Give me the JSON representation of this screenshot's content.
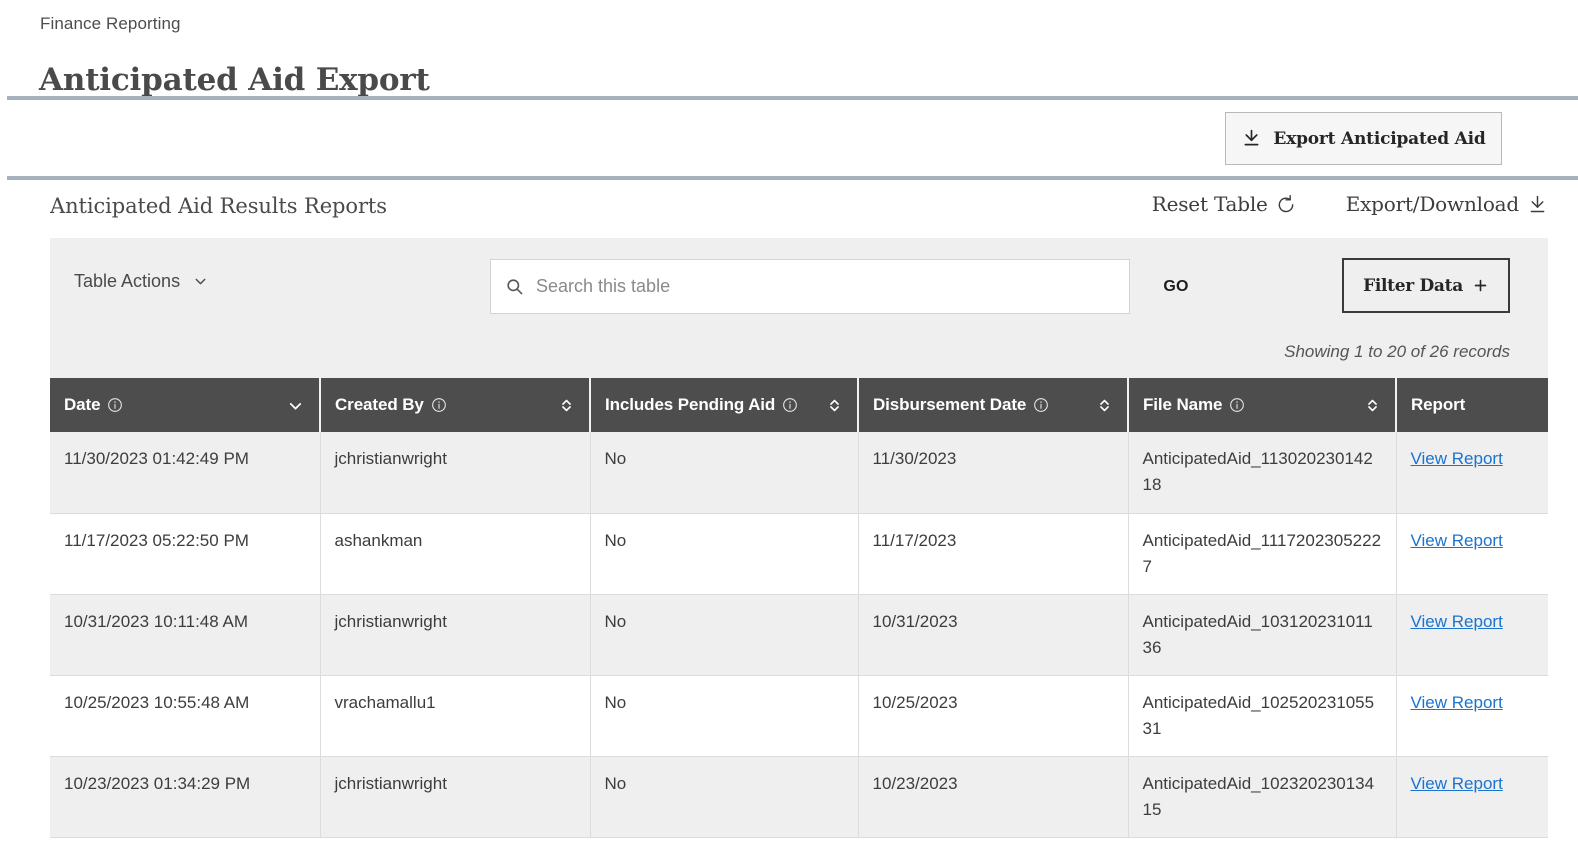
{
  "header": {
    "breadcrumb": "Finance Reporting",
    "title": "Anticipated Aid Export"
  },
  "export_bar": {
    "export_button_label": "Export Anticipated Aid",
    "export_button_icon": "download-tray-icon"
  },
  "section": {
    "title": "Anticipated Aid Results Reports",
    "reset_label": "Reset Table",
    "reset_icon": "refresh-ccw-icon",
    "export_download_label": "Export/Download",
    "export_download_icon": "download-tray-icon"
  },
  "toolbar": {
    "table_actions_label": "Table Actions",
    "table_actions_icon": "chevron-down-icon",
    "search_icon": "search-icon",
    "search_placeholder": "Search this table",
    "search_value": "",
    "go_label": "GO",
    "filter_label": "Filter Data",
    "filter_icon": "plus-icon",
    "records_text": "Showing 1 to 20 of 26 records"
  },
  "table": {
    "columns": [
      {
        "label": "Date",
        "info": true,
        "sort": "desc"
      },
      {
        "label": "Created By",
        "info": true,
        "sort": "none"
      },
      {
        "label": "Includes Pending Aid",
        "info": true,
        "sort": "none"
      },
      {
        "label": "Disbursement Date",
        "info": true,
        "sort": "none"
      },
      {
        "label": "File Name",
        "info": true,
        "sort": "none"
      },
      {
        "label": "Report",
        "info": false,
        "sort": null
      }
    ],
    "rows": [
      {
        "date": "11/30/2023 01:42:49 PM",
        "created_by": "jchristianwright",
        "includes_pending_aid": "No",
        "disbursement_date": "11/30/2023",
        "file_name": "AnticipatedAid_11302023014218",
        "report_link": "View Report"
      },
      {
        "date": "11/17/2023 05:22:50 PM",
        "created_by": "ashankman",
        "includes_pending_aid": "No",
        "disbursement_date": "11/17/2023",
        "file_name": "AnticipatedAid_11172023052227",
        "report_link": "View Report"
      },
      {
        "date": "10/31/2023 10:11:48 AM",
        "created_by": "jchristianwright",
        "includes_pending_aid": "No",
        "disbursement_date": "10/31/2023",
        "file_name": "AnticipatedAid_10312023101136",
        "report_link": "View Report"
      },
      {
        "date": "10/25/2023 10:55:48 AM",
        "created_by": "vrachamallu1",
        "includes_pending_aid": "No",
        "disbursement_date": "10/25/2023",
        "file_name": "AnticipatedAid_10252023105531",
        "report_link": "View Report"
      },
      {
        "date": "10/23/2023 01:34:29 PM",
        "created_by": "jchristianwright",
        "includes_pending_aid": "No",
        "disbursement_date": "10/23/2023",
        "file_name": "AnticipatedAid_10232023013415",
        "report_link": "View Report"
      }
    ]
  },
  "colors": {
    "rule": "#a7b1bd",
    "table_header_bg": "#4d4d4d",
    "row_alt_bg": "#efefef",
    "toolbar_bg": "#efefef",
    "link": "#1a73d0",
    "title_text": "#4a4a4a"
  }
}
